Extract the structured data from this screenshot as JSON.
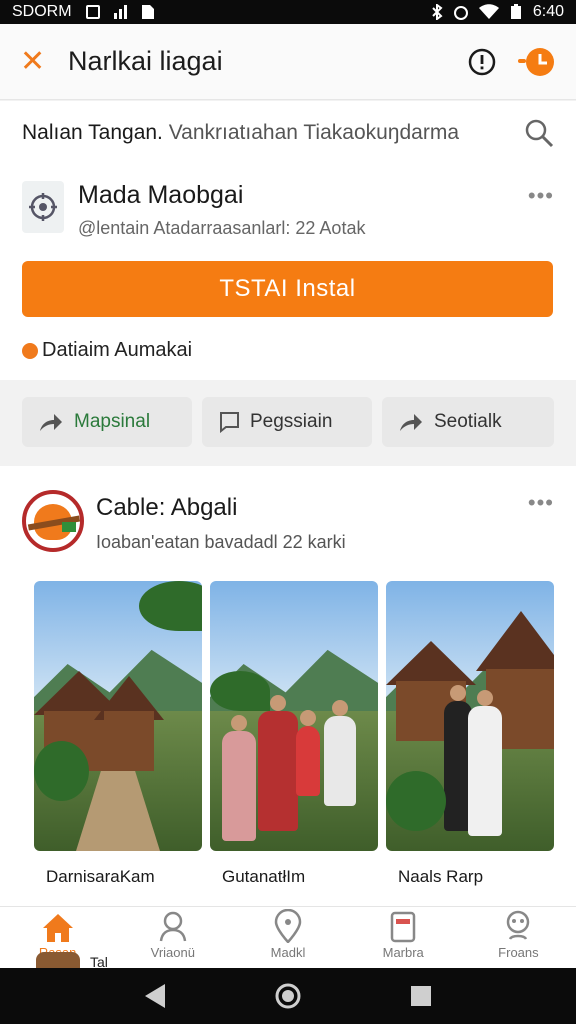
{
  "statusbar": {
    "carrier": "SDORM",
    "time": "6:40"
  },
  "appbar": {
    "title": "Narlkai liagai"
  },
  "search": {
    "query_strong": "Nalıan Tangan.",
    "query_hint": " Vankrıatıahan Tiakaokuŋdarma"
  },
  "app": {
    "name": "Mada Maobgai",
    "subtitle": "@lentain Atadarraasanlarl: 22 Aotak",
    "install_label": "TSTAI Instal",
    "note": "Datiaim Aumakai"
  },
  "chips": [
    {
      "label": "Mapsinal",
      "icon": "share-icon"
    },
    {
      "label": "Pegssiain",
      "icon": "comment-icon"
    },
    {
      "label": "Seotialk",
      "icon": "share-icon"
    }
  ],
  "post": {
    "name": "Cable: Abgali",
    "subtitle": "Ioaban'eatan bavadadl 22 karki",
    "captions": [
      "DarnisaraKam",
      "GutanatłIm",
      "Naals Rarp"
    ]
  },
  "bottomnav": {
    "items": [
      {
        "label": "Rasan",
        "icon": "home-icon"
      },
      {
        "label": "Vriaonü",
        "icon": "profile-icon"
      },
      {
        "label": "Madkl",
        "icon": "location-icon"
      },
      {
        "label": "Marbra",
        "icon": "shop-icon"
      },
      {
        "label": "Froans",
        "icon": "support-icon"
      }
    ]
  },
  "peek": {
    "text": "Tal"
  },
  "colors": {
    "accent": "#f57c12",
    "chip_text_active": "#2b7a3b"
  }
}
